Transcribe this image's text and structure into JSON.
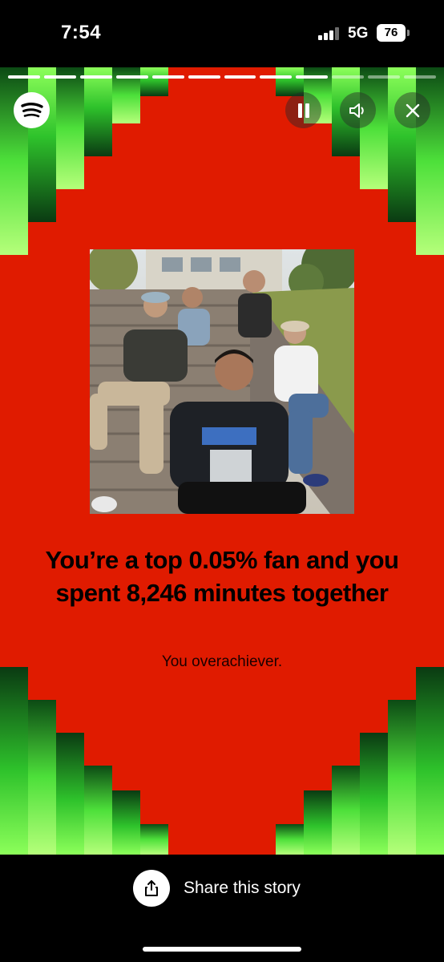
{
  "status_bar": {
    "time": "7:54",
    "network": "5G",
    "battery": "76"
  },
  "story": {
    "progress": {
      "segments_total": 12,
      "segments_done": 9
    },
    "headline": "You’re a top 0.05% fan and you spent 8,246 minutes together",
    "subline": "You overachiever.",
    "background_color": "#e01b00"
  },
  "icons": {
    "logo": "spotify-logo",
    "pause": "pause-icon",
    "sound": "speaker-icon",
    "close": "close-icon",
    "share": "share-icon"
  },
  "share": {
    "label": "Share this story"
  }
}
